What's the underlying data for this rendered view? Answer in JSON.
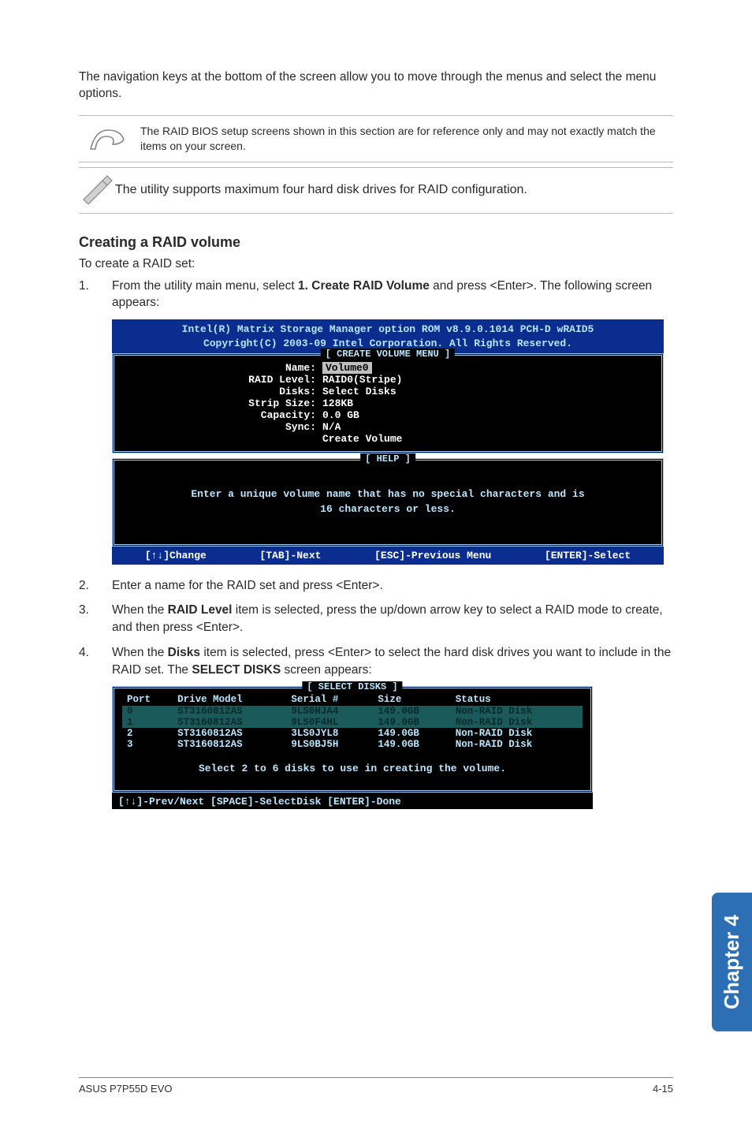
{
  "intro": "The navigation keys at the bottom of the screen allow you to move through the menus and select the menu options.",
  "note1": "The RAID BIOS setup screens shown in this section are for reference only and may not exactly match the items on your screen.",
  "note2": "The utility supports maximum four hard disk drives for RAID configuration.",
  "icons": {
    "note1": "note-hand-icon",
    "note2": "note-pencil-icon"
  },
  "section_head": "Creating a RAID volume",
  "subline": "To create a RAID set:",
  "steps": {
    "s1_num": "1.",
    "s1_pre": "From the utility main menu, select ",
    "s1_bold": "1. Create RAID Volume",
    "s1_post": " and press <Enter>. The following screen appears:",
    "s2_num": "2.",
    "s2": "Enter a name for the RAID set and press <Enter>.",
    "s3_num": "3.",
    "s3_pre": "When the ",
    "s3_bold": "RAID Level",
    "s3_post": " item is selected, press the up/down arrow key to select a RAID mode to create, and then press <Enter>.",
    "s4_num": "4.",
    "s4_pre": "When the ",
    "s4_bold1": "Disks",
    "s4_mid": " item is selected, press <Enter> to select the hard disk drives you want to include in the RAID set. The ",
    "s4_bold2": "SELECT DISKS",
    "s4_post": " screen appears:"
  },
  "bios1": {
    "hdr1": "Intel(R) Matrix Storage Manager option ROM v8.9.0.1014 PCH-D wRAID5",
    "hdr2": "Copyright(C) 2003-09 Intel Corporation.  All Rights Reserved.",
    "panel1_title": "[ CREATE VOLUME MENU ]",
    "fields": {
      "name_lbl": "Name:",
      "name_val": "Volume0",
      "raid_lbl": "RAID Level:",
      "raid_val": "RAID0(Stripe)",
      "disks_lbl": "Disks:",
      "disks_val": "Select Disks",
      "strip_lbl": "Strip Size:",
      "strip_val": "128KB",
      "cap_lbl": "Capacity:",
      "cap_val": "0.0   GB",
      "sync_lbl": "Sync:",
      "sync_val": "N/A",
      "create": "Create Volume"
    },
    "panel2_title": "[ HELP ]",
    "help1": "Enter a unique volume name that has no special characters and is",
    "help2": "16 characters or less.",
    "ftr": {
      "change": "[↑↓]Change",
      "next": "[TAB]-Next",
      "prev": "[ESC]-Previous Menu",
      "select": "[ENTER]-Select"
    }
  },
  "chart_data": {
    "type": "table",
    "title": "[ SELECT DISKS ]",
    "columns": [
      "Port",
      "Drive Model",
      "Serial #",
      "Size",
      "Status"
    ],
    "rows": [
      {
        "port": "0",
        "model": "ST3160812AS",
        "serial": "9LS0HJA4",
        "size": "149.0GB",
        "status": "Non-RAID Disk",
        "selected": true
      },
      {
        "port": "1",
        "model": "ST3160812AS",
        "serial": "9LS0F4HL",
        "size": "149.0GB",
        "status": "Non-RAID Disk",
        "selected": true
      },
      {
        "port": "2",
        "model": "ST3160812AS",
        "serial": "3LS0JYL8",
        "size": "149.0GB",
        "status": "Non-RAID Disk",
        "selected": false
      },
      {
        "port": "3",
        "model": "ST3160812AS",
        "serial": "9LS0BJ5H",
        "size": "149.0GB",
        "status": "Non-RAID Disk",
        "selected": false
      }
    ],
    "msg": "Select 2 to 6 disks to use in creating the volume.",
    "ftr": "[↑↓]-Prev/Next [SPACE]-SelectDisk [ENTER]-Done"
  },
  "side_tab": "Chapter 4",
  "footer_left": "ASUS P7P55D EVO",
  "footer_right": "4-15"
}
